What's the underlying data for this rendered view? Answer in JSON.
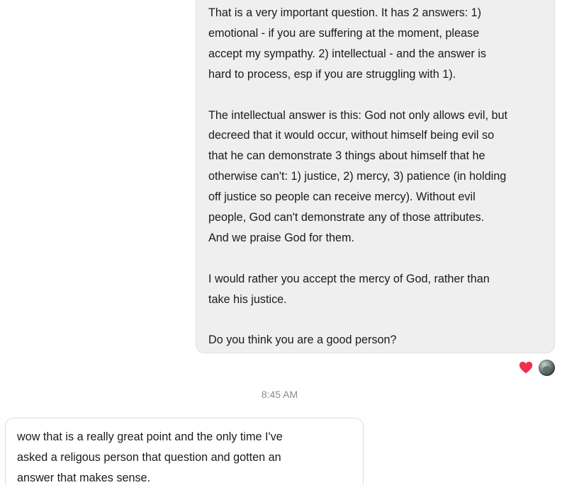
{
  "messages": {
    "sent": {
      "lines": [
        "That is a very important question.  It has 2 answers: 1)",
        "emotional - if you are suffering at the moment, please",
        "accept my sympathy.  2) intellectual - and the answer is",
        "hard to process, esp if you are struggling with 1).",
        "The intellectual answer is this: God not only allows evil, but",
        "decreed that it would occur, without himself being evil so",
        "that he can demonstrate 3 things about himself that he",
        "otherwise can't: 1) justice, 2) mercy, 3) patience (in holding",
        "off justice so people can receive mercy).  Without evil",
        "people, God can't demonstrate any of those attributes.",
        "And we praise God for them.",
        "I would rather you accept the mercy of God, rather than",
        "take his justice.",
        "Do you think you are a good person?"
      ],
      "reactions": {
        "reaction_icon": "heart-icon",
        "reaction_color": "#f0314e",
        "reactor": "avatar"
      }
    },
    "timestamp": "8:45 AM",
    "received": {
      "lines": [
        "wow that is a really great point and the only time I've",
        "asked a religous person that question and gotten an",
        "answer that makes sense."
      ]
    }
  },
  "colors": {
    "sent_bubble": "#efefef",
    "received_bubble": "#ffffff",
    "timestamp_text": "#8a8a8a"
  }
}
